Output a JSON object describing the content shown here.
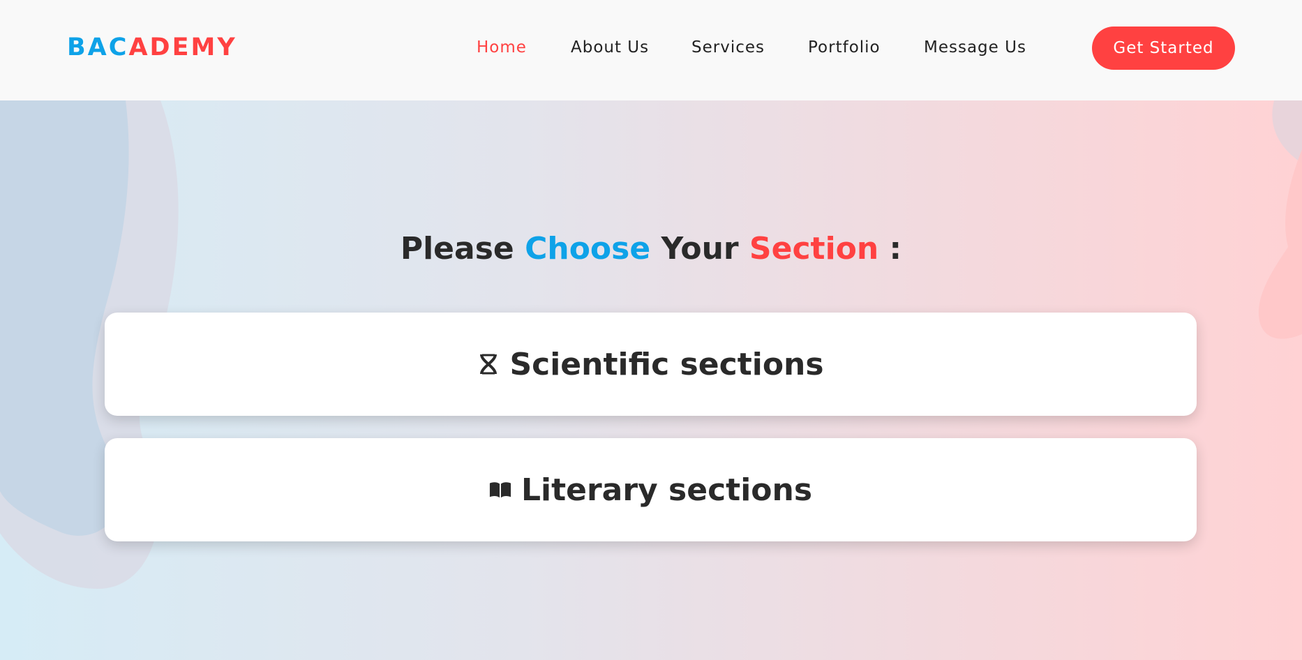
{
  "brand": {
    "part1": "BAC",
    "part2": "ADEMY",
    "color_blue": "#0ea2e8",
    "color_red": "#ff4141"
  },
  "nav": {
    "items": [
      {
        "label": "Home",
        "active": true
      },
      {
        "label": "About Us",
        "active": false
      },
      {
        "label": "Services",
        "active": false
      },
      {
        "label": "Portfolio",
        "active": false
      },
      {
        "label": "Message Us",
        "active": false
      }
    ],
    "cta_label": "Get Started"
  },
  "hero": {
    "title": {
      "part1": "Please",
      "part2": "Choose",
      "part3": "Your",
      "part4": "Section",
      "part5": ":"
    },
    "cards": [
      {
        "label": "Scientific sections",
        "icon": "dna-icon"
      },
      {
        "label": "Literary sections",
        "icon": "open-book-icon"
      }
    ]
  }
}
